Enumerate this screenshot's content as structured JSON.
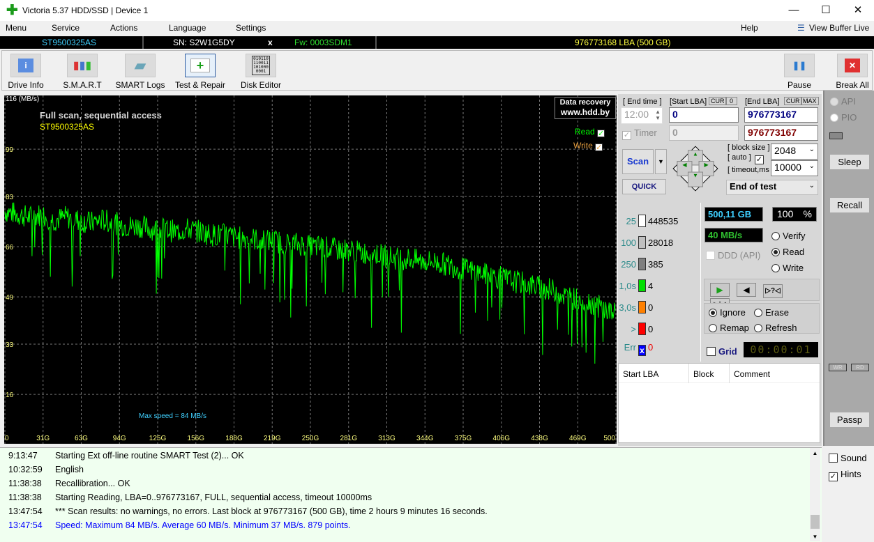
{
  "window": {
    "title": "Victoria 5.37 HDD/SSD | Device 1",
    "minimize": "—",
    "maximize": "☐",
    "close": "✕"
  },
  "menu": {
    "items": [
      "Menu",
      "Service",
      "Actions",
      "Language",
      "Settings"
    ],
    "help": "Help",
    "view_buffer": "View Buffer Live"
  },
  "infobar": {
    "model": "ST9500325AS",
    "serial": "SN: S2W1G5DY",
    "close": "x",
    "firmware": "Fw: 0003SDM1",
    "capacity": "976773168 LBA (500 GB)"
  },
  "toolbar": {
    "items": [
      "Drive Info",
      "S.M.A.R.T",
      "SMART Logs",
      "Test & Repair",
      "Disk Editor"
    ],
    "pause": "Pause",
    "break_all": "Break All"
  },
  "chart_data": {
    "type": "line",
    "title": "Full scan, sequential access",
    "subtitle": "ST9500325AS",
    "ylabel": "116 (MB/s)",
    "ylim": [
      0,
      116
    ],
    "xlim": [
      0,
      500
    ],
    "yticks": [
      "99",
      "83",
      "66",
      "49",
      "33",
      "16"
    ],
    "ytick_values": [
      99,
      83,
      66,
      49,
      33,
      16
    ],
    "xticks": [
      "0",
      "31G",
      "63G",
      "94G",
      "125G",
      "156G",
      "188G",
      "219G",
      "250G",
      "281G",
      "313G",
      "344G",
      "375G",
      "406G",
      "438G",
      "469G",
      "500"
    ],
    "grid": true,
    "annotation": "Max speed = 84 MB/s",
    "watermark": [
      "Data recovery",
      "www.hdd.by"
    ],
    "legend": {
      "placement": "top-right",
      "entries": [
        {
          "name": "Read",
          "checked": true,
          "color": "#00ff00"
        },
        {
          "name": "Write",
          "checked": true,
          "color": "#e8a040"
        }
      ]
    },
    "series": [
      {
        "name": "Read",
        "color": "#00ff00",
        "x": [
          0,
          10,
          20,
          30,
          40,
          50,
          60,
          70,
          80,
          90,
          100,
          110,
          120,
          130,
          140,
          150,
          160,
          170,
          180,
          190,
          200,
          210,
          220,
          230,
          240,
          250,
          260,
          270,
          280,
          290,
          300,
          310,
          320,
          330,
          340,
          350,
          360,
          370,
          380,
          390,
          400,
          410,
          420,
          430,
          440,
          450,
          460,
          470,
          480,
          490,
          500
        ],
        "y": [
          78,
          77,
          76,
          77,
          75,
          76,
          75,
          74,
          75,
          74,
          73,
          73,
          72,
          72,
          71,
          72,
          71,
          70,
          70,
          69,
          69,
          68,
          68,
          67,
          67,
          66,
          66,
          65,
          65,
          64,
          64,
          63,
          62,
          62,
          61,
          61,
          60,
          59,
          58,
          57,
          56,
          55,
          54,
          53,
          52,
          51,
          49,
          48,
          47,
          45,
          43
        ]
      }
    ]
  },
  "panel": {
    "end_time_label": "[ End time ]",
    "end_time": "12:00",
    "start_lba_label": "[Start LBA]",
    "cur": "CUR",
    "cur_value": "0",
    "end_lba_label": "[End LBA]",
    "max": "MAX",
    "start_lba": "0",
    "end_lba": "976773167",
    "timer_label": "Timer",
    "timer_value": "0",
    "end_lba2": "976773167",
    "scan": "Scan",
    "quick": "QUICK",
    "block_size_label": "[ block size ]",
    "auto_label": "[ auto ]",
    "timeout_label": "[ timeout,ms ]",
    "block_size": "2048",
    "timeout": "10000",
    "end_action": "End of test"
  },
  "stats": {
    "rows": [
      {
        "label": "25",
        "count": "448535",
        "color": "#ffffff"
      },
      {
        "label": "100",
        "count": "28018",
        "color": "#c0c0c0"
      },
      {
        "label": "250",
        "count": "385",
        "color": "#808080"
      },
      {
        "label": "1,0s",
        "count": "4",
        "color": "#00e000"
      },
      {
        "label": "3,0s",
        "count": "0",
        "color": "#ff8000"
      },
      {
        "label": ">",
        "count": "0",
        "color": "#ff0000"
      }
    ],
    "err_label": "Err",
    "err_count": "0"
  },
  "status": {
    "size": "500,11 GB",
    "percent": "100",
    "percent_sign": "%",
    "speed": "40 MB/s",
    "ddd": "DDD (API)",
    "modes": [
      "Verify",
      "Read",
      "Write"
    ],
    "selected_mode": "Read",
    "actions": [
      "Ignore",
      "Erase",
      "Remap",
      "Refresh"
    ],
    "selected_action": "Ignore",
    "grid": "Grid",
    "timer": "00:00:01"
  },
  "result_table": {
    "columns": [
      "Start LBA",
      "Block",
      "Comment"
    ]
  },
  "side": {
    "api": "API",
    "pio": "PIO",
    "sleep": "Sleep",
    "recall": "Recall",
    "wr": "WR",
    "rd": "RD",
    "passp": "Passp"
  },
  "log": [
    {
      "time": "9:13:47",
      "msg": "Starting Ext off-line routine SMART Test (2)... OK"
    },
    {
      "time": "10:32:59",
      "msg": "English"
    },
    {
      "time": "11:38:38",
      "msg": "Recallibration... OK"
    },
    {
      "time": "11:38:38",
      "msg": "Starting Reading, LBA=0..976773167, FULL, sequential access, timeout 10000ms"
    },
    {
      "time": "13:47:54",
      "msg": "*** Scan results: no warnings, no errors. Last block at 976773167 (500 GB), time 2 hours 9 minutes 16 seconds."
    },
    {
      "time": "13:47:54",
      "msg": "Speed: Maximum 84 MB/s. Average 60 MB/s. Minimum 37 MB/s. 879 points.",
      "color": "#0000ff"
    }
  ],
  "log_options": {
    "sound": "Sound",
    "hints": "Hints"
  }
}
